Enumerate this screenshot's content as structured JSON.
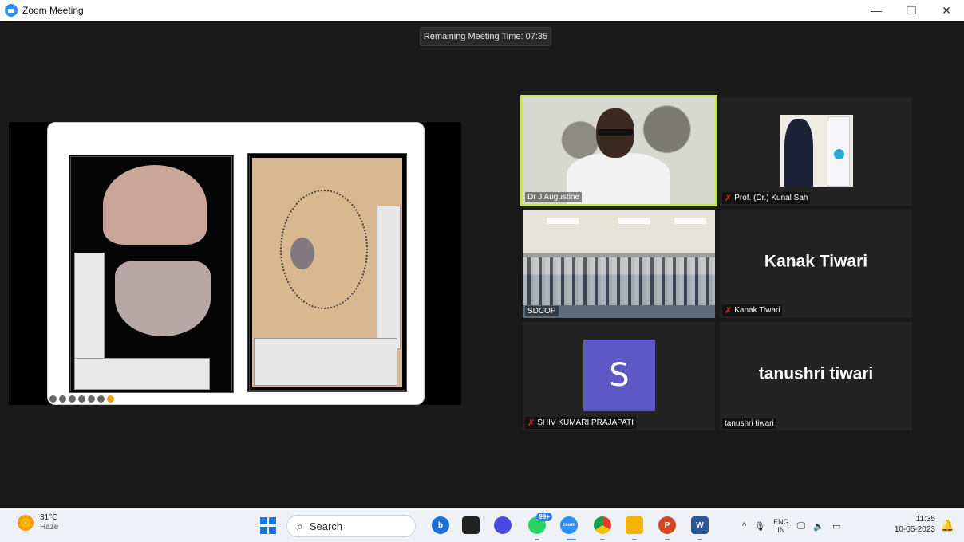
{
  "window": {
    "title": "Zoom Meeting",
    "minimize": "—",
    "restore": "❐",
    "close": "✕"
  },
  "meeting": {
    "timer_text": "Remaining Meeting Time: 07:35"
  },
  "participants": [
    {
      "name": "Dr J Augustine",
      "muted": false,
      "display": "video"
    },
    {
      "name": "Prof. (Dr.) Kunal Sah",
      "muted": true,
      "display": "video"
    },
    {
      "name": "SDCOP",
      "muted": false,
      "display": "video"
    },
    {
      "name": "Kanak Tiwari",
      "muted": true,
      "display": "name",
      "big_name": "Kanak Tiwari"
    },
    {
      "name": "SHIV KUMARI PRAJAPATI",
      "muted": true,
      "display": "avatar",
      "avatar_letter": "S",
      "avatar_color": "#5c58c4"
    },
    {
      "name": "tanushri tiwari",
      "muted": false,
      "display": "name",
      "big_name": "tanushri tiwari"
    }
  ],
  "taskbar": {
    "weather": {
      "temp": "31°C",
      "condition": "Haze"
    },
    "search_label": "Search",
    "apps": [
      {
        "icon": "bing-chat-icon",
        "color": "#1b6fd6",
        "glyph": "b"
      },
      {
        "icon": "task-view-icon",
        "color": "#222",
        "glyph": ""
      },
      {
        "icon": "meet-icon",
        "color": "#4a4ae0",
        "glyph": ""
      },
      {
        "icon": "whatsapp-icon",
        "color": "#25d366",
        "glyph": "",
        "badge": "99+"
      },
      {
        "icon": "zoom-icon",
        "color": "#2d8cff",
        "glyph": "zoom"
      },
      {
        "icon": "chrome-icon",
        "color": "#e33b2e",
        "glyph": ""
      },
      {
        "icon": "file-explorer-icon",
        "color": "#f4b400",
        "glyph": ""
      },
      {
        "icon": "powerpoint-icon",
        "color": "#d24726",
        "glyph": "P"
      },
      {
        "icon": "word-icon",
        "color": "#2b579a",
        "glyph": "W"
      }
    ],
    "tray": {
      "chevron": "^",
      "mic": "🎙",
      "lang_top": "ENG",
      "lang_bottom": "IN",
      "net": "🖵",
      "vol": "🔈",
      "battery": "▭"
    },
    "clock": {
      "time": "11:35",
      "date": "10-05-2023"
    },
    "bell": "🔔"
  }
}
